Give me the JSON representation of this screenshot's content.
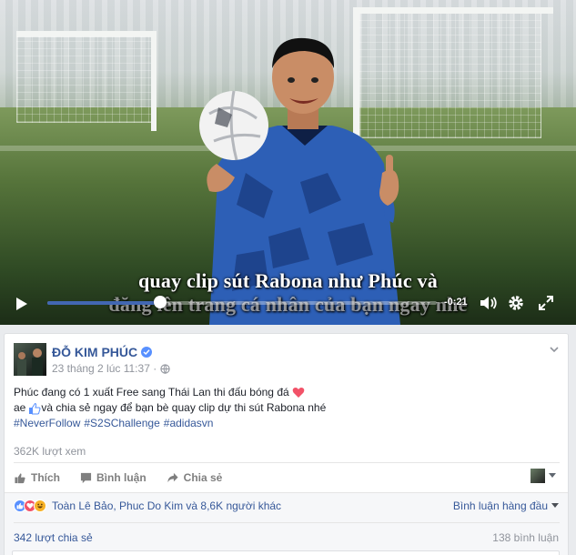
{
  "video": {
    "subtitle_line1": "quay clip sút Rabona như Phúc và",
    "subtitle_line2": "đăng lên trang cá nhân của bạn ngay nhé",
    "time_remaining": "-0:21",
    "progress": 0.29,
    "accent_color": "#4267b2"
  },
  "post": {
    "author": "ĐỖ KIM PHÚC",
    "timestamp": "23 tháng 2 lúc 11:37 ·",
    "text_line1": "Phúc đang có 1 xuất Free sang Thái Lan thi đấu bóng đá",
    "text_line2_prefix": "ae",
    "text_line2_suffix": " và chia sẻ ngay để bạn bè quay clip dự thi sút Rabona nhé",
    "hashtags": [
      "#NeverFollow",
      "#S2SChallenge",
      "#adidasvn"
    ],
    "views": "362K lượt xem",
    "actions": {
      "like": "Thích",
      "comment": "Bình luận",
      "share": "Chia sẻ"
    },
    "reactions_text": "Toàn Lê Bảo, Phuc Do Kim và 8,6K người khác",
    "sort_label": "Bình luận hàng đầu",
    "shares": "342 lượt chia sẻ",
    "comments": "138 bình luận",
    "link_color": "#365899"
  },
  "icons": [
    "play-icon",
    "volume-icon",
    "settings-gear-icon",
    "fullscreen-icon",
    "verified-badge-icon",
    "globe-icon",
    "chevron-down-icon",
    "like-thumb-icon",
    "comment-bubble-icon",
    "share-arrow-icon",
    "heart-icon",
    "haha-icon"
  ]
}
